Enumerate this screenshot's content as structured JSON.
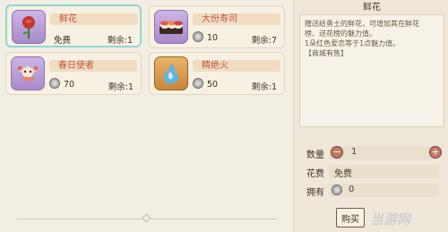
{
  "items": [
    {
      "name": "鲜花",
      "price": "免费",
      "remain": "剩余:1",
      "icon": "rose-icon",
      "has_coin": false,
      "selected": true
    },
    {
      "name": "大份寿司",
      "price": "10",
      "remain": "剩余:7",
      "icon": "sushi-icon",
      "has_coin": true,
      "selected": false
    },
    {
      "name": "春日使者",
      "price": "70",
      "remain": "剩余:1",
      "icon": "spring-envoy-icon",
      "has_coin": true,
      "selected": false
    },
    {
      "name": "精绝火",
      "price": "50",
      "remain": "剩余:1",
      "icon": "fire-icon",
      "has_coin": true,
      "selected": false
    }
  ],
  "detail": {
    "title": "鲜花",
    "description_lines": [
      "赠送给勇士的鲜花，可增加其在鲜花",
      "榜、送花榜的魅力值。",
      "1朵红色爱恋等于1点魅力值。",
      "【商城有售】"
    ],
    "quantity_label": "数量",
    "quantity_value": "1",
    "cost_label": "花费",
    "cost_value": "免费",
    "owned_label": "拥有",
    "owned_value": "0",
    "buy_label": "购买"
  },
  "watermark": "当游网"
}
